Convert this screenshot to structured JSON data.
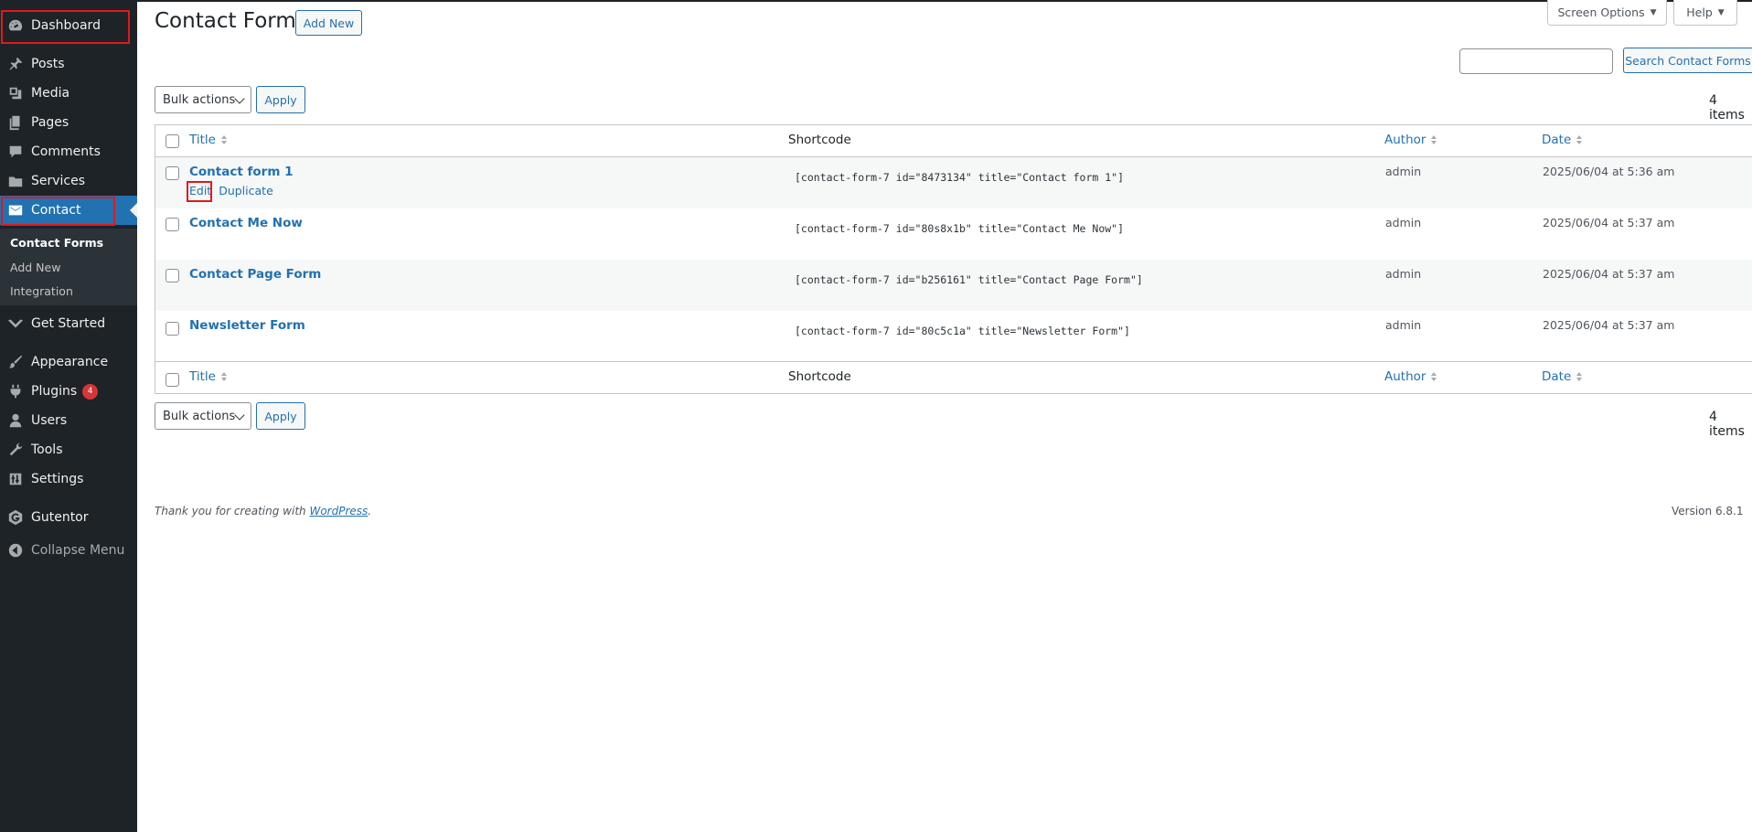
{
  "sidebar": {
    "items": [
      {
        "label": "Dashboard",
        "icon": "dashboard-icon"
      },
      {
        "label": "Posts",
        "icon": "pin-icon"
      },
      {
        "label": "Media",
        "icon": "media-icon"
      },
      {
        "label": "Pages",
        "icon": "pages-icon"
      },
      {
        "label": "Comments",
        "icon": "comment-icon"
      },
      {
        "label": "Services",
        "icon": "folder-icon"
      },
      {
        "label": "Contact",
        "icon": "mail-icon"
      },
      {
        "label": "Get Started",
        "icon": "chevron-logo-icon"
      },
      {
        "label": "Appearance",
        "icon": "brush-icon"
      },
      {
        "label": "Plugins",
        "icon": "plugin-icon",
        "badge": "4"
      },
      {
        "label": "Users",
        "icon": "user-icon"
      },
      {
        "label": "Tools",
        "icon": "wrench-icon"
      },
      {
        "label": "Settings",
        "icon": "settings-icon"
      },
      {
        "label": "Gutentor",
        "icon": "gutentor-icon"
      }
    ],
    "submenu": [
      "Contact Forms",
      "Add New",
      "Integration"
    ],
    "collapse": "Collapse Menu"
  },
  "header": {
    "title": "Contact Forms",
    "add_new": "Add New",
    "screen_options": "Screen Options",
    "help": "Help",
    "search_button": "Search Contact Forms",
    "search_value": ""
  },
  "bulk": {
    "select": "Bulk actions",
    "apply": "Apply",
    "count": "4 items"
  },
  "table": {
    "columns": {
      "title": "Title",
      "shortcode": "Shortcode",
      "author": "Author",
      "date": "Date"
    },
    "row_actions": {
      "edit": "Edit",
      "duplicate": "Duplicate"
    },
    "rows": [
      {
        "title": "Contact form 1",
        "shortcode": "[contact-form-7 id=\"8473134\" title=\"Contact form 1\"]",
        "author": "admin",
        "date": "2025/06/04 at 5:36 am"
      },
      {
        "title": "Contact Me Now",
        "shortcode": "[contact-form-7 id=\"80s8x1b\" title=\"Contact Me Now\"]",
        "author": "admin",
        "date": "2025/06/04 at 5:37 am"
      },
      {
        "title": "Contact Page Form",
        "shortcode": "[contact-form-7 id=\"b256161\" title=\"Contact Page Form\"]",
        "author": "admin",
        "date": "2025/06/04 at 5:37 am"
      },
      {
        "title": "Newsletter Form",
        "shortcode": "[contact-form-7 id=\"80c5c1a\" title=\"Newsletter Form\"]",
        "author": "admin",
        "date": "2025/06/04 at 5:37 am"
      }
    ]
  },
  "footer": {
    "thanks_prefix": "Thank you for creating with ",
    "thanks_link": "WordPress",
    "thanks_suffix": ".",
    "version": "Version 6.8.1"
  },
  "colors": {
    "sidebar_bg": "#1d2327",
    "accent": "#2271b1",
    "highlight": "#e0191e",
    "badge": "#d63638"
  }
}
